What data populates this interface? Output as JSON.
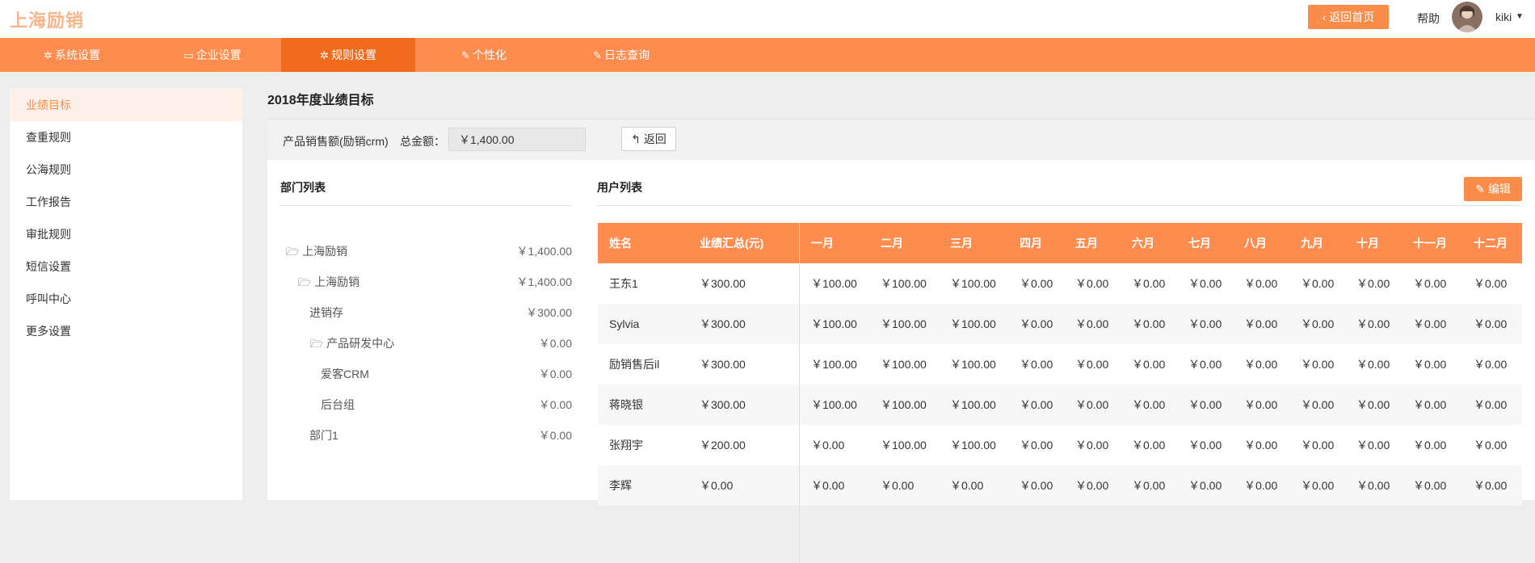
{
  "header": {
    "logo": "上海励销",
    "back_home_label": "返回首页",
    "help_label": "帮助",
    "username": "kiki"
  },
  "nav": {
    "items": [
      {
        "label": "系统设置",
        "icon": "gear-icon"
      },
      {
        "label": "企业设置",
        "icon": "monitor-icon"
      },
      {
        "label": "规则设置",
        "icon": "gear-icon"
      },
      {
        "label": "个性化",
        "icon": "edit-icon"
      },
      {
        "label": "日志查询",
        "icon": "edit-icon"
      }
    ],
    "active_index": 2
  },
  "sidebar": {
    "items": [
      {
        "label": "业绩目标"
      },
      {
        "label": "查重规则"
      },
      {
        "label": "公海规则"
      },
      {
        "label": "工作报告"
      },
      {
        "label": "审批规则"
      },
      {
        "label": "短信设置"
      },
      {
        "label": "呼叫中心"
      },
      {
        "label": "更多设置"
      }
    ],
    "active_index": 0
  },
  "page": {
    "title": "2018年度业绩目标"
  },
  "filter": {
    "product_label": "产品销售额(励销crm)",
    "total_label": "总金额：",
    "total_value": "￥1,400.00",
    "back_label": "返回"
  },
  "dept_panel": {
    "title": "部门列表",
    "rows": [
      {
        "name": "上海励销",
        "amount": "￥1,400.00",
        "folder": true,
        "level": 0
      },
      {
        "name": "上海励销",
        "amount": "￥1,400.00",
        "folder": true,
        "level": 1
      },
      {
        "name": "进销存",
        "amount": "￥300.00",
        "folder": false,
        "level": 2
      },
      {
        "name": "产品研发中心",
        "amount": "￥0.00",
        "folder": true,
        "level": 2
      },
      {
        "name": "爱客CRM",
        "amount": "￥0.00",
        "folder": false,
        "level": 3
      },
      {
        "name": "后台组",
        "amount": "￥0.00",
        "folder": false,
        "level": 3
      },
      {
        "name": "部门1",
        "amount": "￥0.00",
        "folder": false,
        "level": 2
      }
    ]
  },
  "user_panel": {
    "title": "用户列表",
    "edit_label": "编辑",
    "columns": [
      "姓名",
      "业绩汇总(元)",
      "一月",
      "二月",
      "三月",
      "四月",
      "五月",
      "六月",
      "七月",
      "八月",
      "九月",
      "十月",
      "十一月",
      "十二月"
    ],
    "rows": [
      [
        "王东1",
        "￥300.00",
        "￥100.00",
        "￥100.00",
        "￥100.00",
        "￥0.00",
        "￥0.00",
        "￥0.00",
        "￥0.00",
        "￥0.00",
        "￥0.00",
        "￥0.00",
        "￥0.00",
        "￥0.00"
      ],
      [
        "Sylvia",
        "￥300.00",
        "￥100.00",
        "￥100.00",
        "￥100.00",
        "￥0.00",
        "￥0.00",
        "￥0.00",
        "￥0.00",
        "￥0.00",
        "￥0.00",
        "￥0.00",
        "￥0.00",
        "￥0.00"
      ],
      [
        "励销售后il",
        "￥300.00",
        "￥100.00",
        "￥100.00",
        "￥100.00",
        "￥0.00",
        "￥0.00",
        "￥0.00",
        "￥0.00",
        "￥0.00",
        "￥0.00",
        "￥0.00",
        "￥0.00",
        "￥0.00"
      ],
      [
        "蒋晓银",
        "￥300.00",
        "￥100.00",
        "￥100.00",
        "￥100.00",
        "￥0.00",
        "￥0.00",
        "￥0.00",
        "￥0.00",
        "￥0.00",
        "￥0.00",
        "￥0.00",
        "￥0.00",
        "￥0.00"
      ],
      [
        "张翔宇",
        "￥200.00",
        "￥0.00",
        "￥100.00",
        "￥100.00",
        "￥0.00",
        "￥0.00",
        "￥0.00",
        "￥0.00",
        "￥0.00",
        "￥0.00",
        "￥0.00",
        "￥0.00",
        "￥0.00"
      ],
      [
        "李辉",
        "￥0.00",
        "￥0.00",
        "￥0.00",
        "￥0.00",
        "￥0.00",
        "￥0.00",
        "￥0.00",
        "￥0.00",
        "￥0.00",
        "￥0.00",
        "￥0.00",
        "￥0.00",
        "￥0.00"
      ]
    ]
  },
  "colors": {
    "accent": "#fd8c4e",
    "accent_dark": "#f06b1c",
    "logo": "#f9b48a"
  }
}
